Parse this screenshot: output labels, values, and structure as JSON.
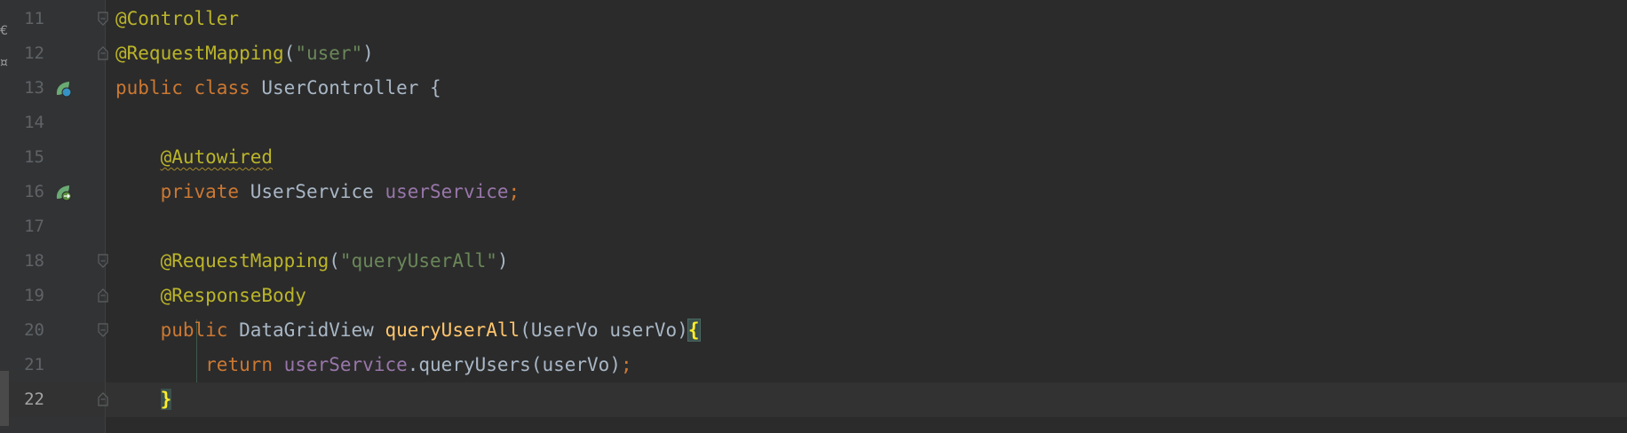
{
  "editor": {
    "left_strip_marks": [
      "€",
      "¤"
    ],
    "current_line": 22,
    "lines": [
      {
        "number": "11",
        "tokens": [
          {
            "t": "@Controller",
            "c": "ann"
          }
        ]
      },
      {
        "number": "12",
        "tokens": [
          {
            "t": "@RequestMapping",
            "c": "ann"
          },
          {
            "t": "(",
            "c": "plain"
          },
          {
            "t": "\"user\"",
            "c": "str"
          },
          {
            "t": ")",
            "c": "plain"
          }
        ]
      },
      {
        "number": "13",
        "tokens": [
          {
            "t": "public ",
            "c": "kw"
          },
          {
            "t": "class ",
            "c": "kw"
          },
          {
            "t": "UserController {",
            "c": "plain"
          }
        ]
      },
      {
        "number": "14",
        "tokens": []
      },
      {
        "number": "15",
        "tokens": [
          {
            "t": "    ",
            "c": "plain"
          },
          {
            "t": "@Autowired",
            "c": "ann wavy"
          }
        ]
      },
      {
        "number": "16",
        "tokens": [
          {
            "t": "    ",
            "c": "plain"
          },
          {
            "t": "private ",
            "c": "kw"
          },
          {
            "t": "UserService ",
            "c": "plain"
          },
          {
            "t": "userService",
            "c": "fld"
          },
          {
            "t": ";",
            "c": "kw"
          }
        ]
      },
      {
        "number": "17",
        "tokens": []
      },
      {
        "number": "18",
        "tokens": [
          {
            "t": "    ",
            "c": "plain"
          },
          {
            "t": "@RequestMapping",
            "c": "ann"
          },
          {
            "t": "(",
            "c": "plain"
          },
          {
            "t": "\"queryUserAll\"",
            "c": "str"
          },
          {
            "t": ")",
            "c": "plain"
          }
        ]
      },
      {
        "number": "19",
        "tokens": [
          {
            "t": "    ",
            "c": "plain"
          },
          {
            "t": "@ResponseBody",
            "c": "ann"
          }
        ]
      },
      {
        "number": "20",
        "tokens": [
          {
            "t": "    ",
            "c": "plain"
          },
          {
            "t": "public ",
            "c": "kw"
          },
          {
            "t": "DataGridView ",
            "c": "plain"
          },
          {
            "t": "queryUserAll",
            "c": "fn"
          },
          {
            "t": "(UserVo userVo)",
            "c": "plain"
          },
          {
            "t": "{",
            "c": "brace-match"
          }
        ]
      },
      {
        "number": "21",
        "tokens": [
          {
            "t": "        ",
            "c": "plain"
          },
          {
            "t": "return ",
            "c": "kw"
          },
          {
            "t": "userService",
            "c": "fld"
          },
          {
            "t": ".queryUsers(userVo)",
            "c": "plain"
          },
          {
            "t": ";",
            "c": "kw"
          }
        ]
      },
      {
        "number": "22",
        "tokens": [
          {
            "t": "    ",
            "c": "plain"
          },
          {
            "t": "}",
            "c": "brace-match-close"
          }
        ]
      }
    ],
    "gutter_icons": {
      "13": "spring-bean-class-icon",
      "16": "spring-autowired-navigate-icon"
    },
    "fold_markers": {
      "11": "fold-start",
      "12": "fold-end",
      "18": "fold-start",
      "19": "fold-end",
      "20": "fold-start",
      "22": "fold-end"
    },
    "colors": {
      "background": "#2b2b2b",
      "gutter": "#313335",
      "keyword": "#cc7832",
      "annotation": "#bbb529",
      "string": "#6a8759",
      "field": "#9876aa",
      "method_declaration": "#ffc66d",
      "plain": "#a9b7c6",
      "line_number": "#606366"
    }
  }
}
